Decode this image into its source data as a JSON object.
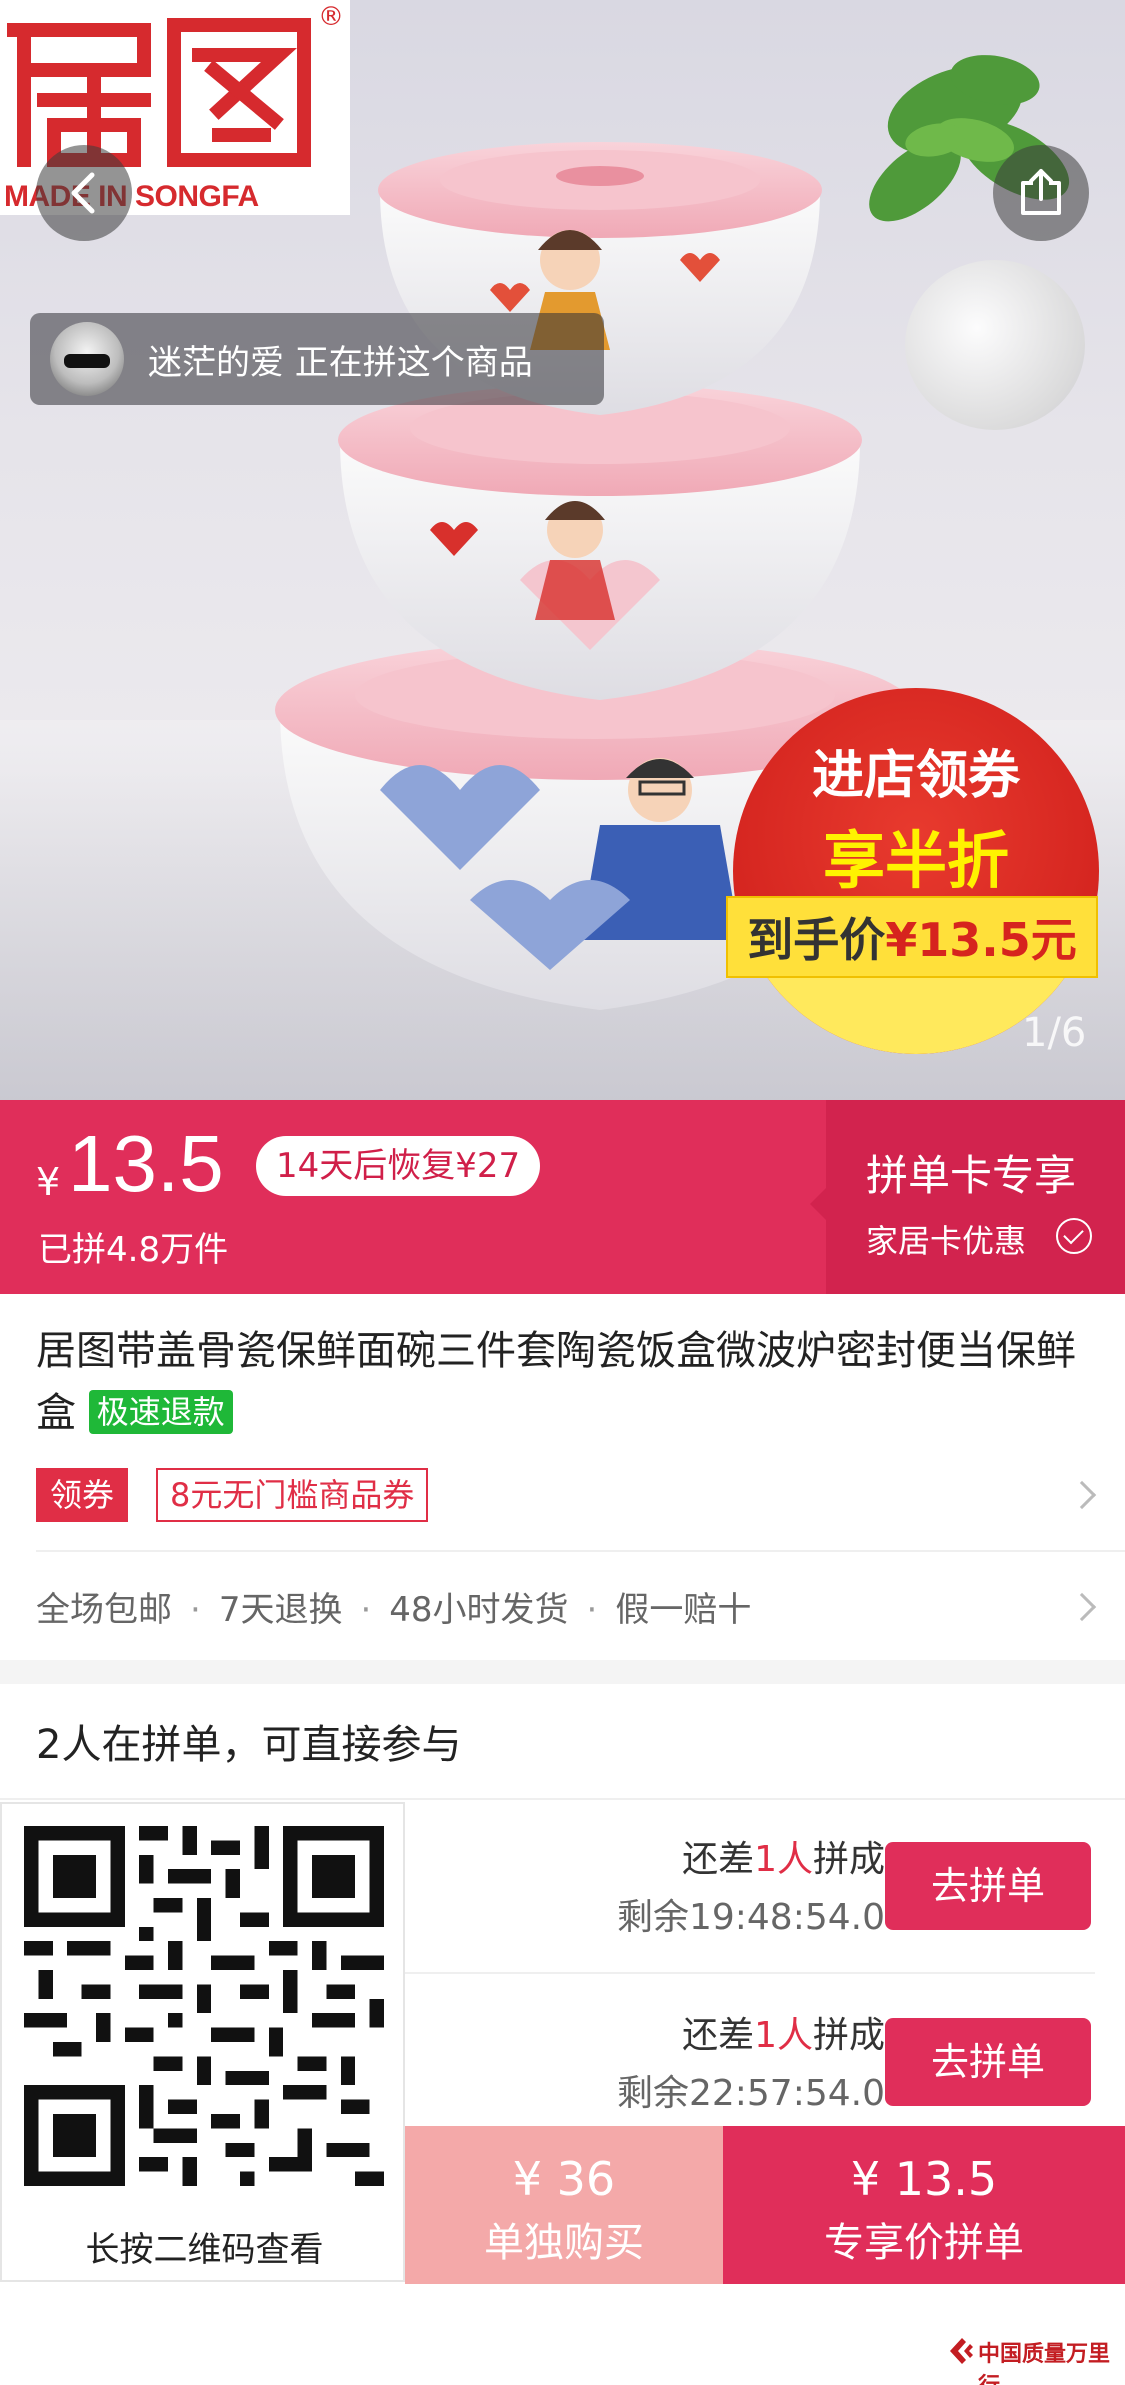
{
  "hero": {
    "brand_logo_text": "居图",
    "brand_tagline": "MADE IN SONGFA",
    "brand_registered": "®",
    "buyer_notice": "迷茫的爱 正在拼这个商品",
    "promo_line1": "进店领券",
    "promo_line2": "享半折",
    "promo_band_label": "到手价",
    "promo_band_price": "¥13.5元",
    "page_indicator": "1/6"
  },
  "price_bar": {
    "currency": "¥",
    "price": "13.5",
    "restore_note": "14天后恢复¥27",
    "sold_count": "已拼4.8万件",
    "card_title": "拼单卡专享",
    "card_subtitle": "家居卡优惠"
  },
  "product": {
    "title": "居图带盖骨瓷保鲜面碗三件套陶瓷饭盒微波炉密封便当保鲜盒",
    "fast_refund_badge": "极速退款",
    "coupon_tag": "领券",
    "coupon_value": "8元无门槛商品券",
    "services": [
      "全场包邮",
      "7天退换",
      "48小时发货",
      "假一赔十"
    ]
  },
  "group": {
    "heading": "2人在拼单，可直接参与",
    "items": [
      {
        "need_prefix": "还差",
        "need_count": "1人",
        "need_suffix": "拼成",
        "remaining": "剩余19:48:54.0",
        "button": "去拼单"
      },
      {
        "need_prefix": "还差",
        "need_count": "1人",
        "need_suffix": "拼成",
        "remaining": "剩余22:57:54.0",
        "button": "去拼单"
      }
    ]
  },
  "qr": {
    "caption": "长按二维码查看"
  },
  "bottom_bar": {
    "alone_price": "¥ 36",
    "alone_label": "单独购买",
    "group_price": "¥ 13.5",
    "group_label": "专享价拼单"
  },
  "watermark": "中国质量万里行",
  "colors": {
    "accent": "#e02e5a",
    "accent_dark": "#d2234e",
    "coupon_red": "#e02e46",
    "refund_green": "#1fb838",
    "alone_pink": "#f4a9a9"
  }
}
